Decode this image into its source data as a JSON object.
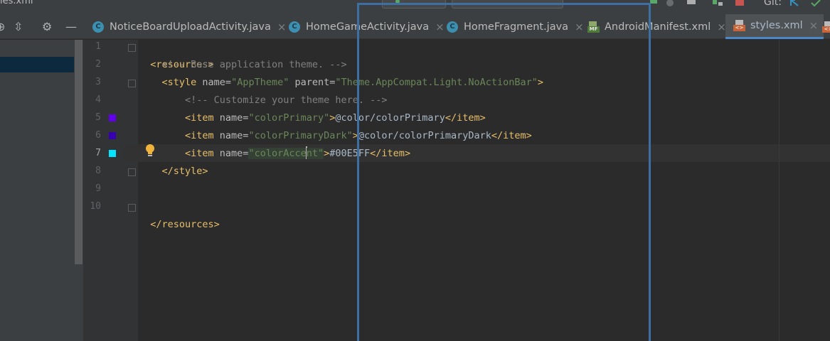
{
  "window": {
    "title": "les.xml",
    "git_label": "Git:"
  },
  "tabs": [
    {
      "label": "NoticeBoardUploadActivity.java",
      "icon": "java-class-icon",
      "close": "×",
      "active": false
    },
    {
      "label": "HomeGameActivity.java",
      "icon": "java-class-icon",
      "close": "×",
      "active": false
    },
    {
      "label": "HomeFragment.java",
      "icon": "java-class-icon",
      "close": "×",
      "active": false
    },
    {
      "label": "AndroidManifest.xml",
      "icon": "manifest-icon",
      "close": "×",
      "active": false
    },
    {
      "label": "styles.xml",
      "icon": "xml-file-icon",
      "close": "×",
      "active": true
    }
  ],
  "icons": {
    "class_letter": "C",
    "manifest_letters": "MF",
    "xml_letters": "<>",
    "toolbar": [
      "target-icon",
      "collapse-icon",
      "gear-icon",
      "minimize-icon"
    ]
  },
  "gutter": {
    "line_numbers": [
      "1",
      "2",
      "3",
      "4",
      "5",
      "6",
      "7",
      "8",
      "9",
      "10"
    ],
    "current_line": "7",
    "swatches": [
      {
        "line": "5",
        "color": "#6200EE"
      },
      {
        "line": "6",
        "color": "#3700B3"
      },
      {
        "line": "7",
        "color": "#00E5FF"
      }
    ]
  },
  "code": {
    "l1": {
      "tag": "<resources>"
    },
    "l2": {
      "comment": "<!-- Base application theme. -->"
    },
    "l3": {
      "open": "<style",
      "attr1": " name=",
      "val1": "\"AppTheme\"",
      "attr2": " parent=",
      "val2": "\"Theme.AppCompat.Light.NoActionBar\"",
      "close": ">"
    },
    "l4": {
      "comment": "<!-- Customize your theme here. -->"
    },
    "l5": {
      "open": "<item",
      "attr": " name=",
      "val": "\"colorPrimary\"",
      "gt": ">",
      "text": "@color/colorPrimary",
      "close": "</item>"
    },
    "l6": {
      "open": "<item",
      "attr": " name=",
      "val": "\"colorPrimaryDark\"",
      "gt": ">",
      "text": "@color/colorPrimaryDark",
      "close": "</item>"
    },
    "l7": {
      "open": "<item",
      "attr": " name=",
      "val_a": "\"colorAcce",
      "val_b": "nt\"",
      "gt": ">",
      "text": "#00E5FF",
      "close": "</item>"
    },
    "l8": {
      "tag": "</style>"
    },
    "l10": {
      "tag": "</resources>"
    }
  },
  "colors": {
    "accent": "#4a88c7",
    "overlay": "#3d6fa3"
  }
}
